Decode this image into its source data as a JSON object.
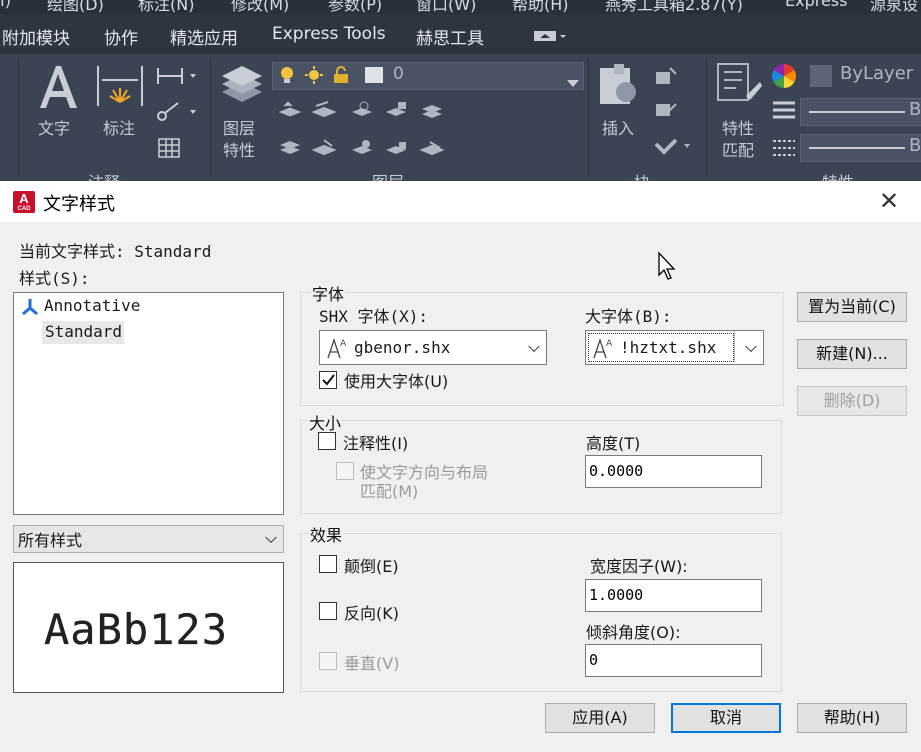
{
  "menubar": {
    "items": [
      "I)",
      "绘图(D)",
      "标注(N)",
      "修改(M)",
      "参数(P)",
      "窗口(W)",
      "帮助(H)",
      "燕秀工具箱2.87(Y)",
      "Express",
      "源泉设"
    ]
  },
  "tabs": [
    "附加模块",
    "协作",
    "精选应用",
    "Express Tools",
    "赫思工具"
  ],
  "ribbon": {
    "text_label": "文字",
    "dim_label": "标注",
    "layer_props": [
      "图层",
      "特性"
    ],
    "layer_value": "0",
    "insert_label": "插入",
    "match_props": [
      "特性",
      "匹配"
    ],
    "bylayer_label": "ByLayer",
    "line1_end": "B",
    "line2_end": "B",
    "group_labels": [
      "注释",
      "图层",
      "块",
      "特性"
    ]
  },
  "dialog": {
    "title": "文字样式",
    "app_icon_letter": "A",
    "app_icon_sub": "CAD",
    "close_glyph": "✕",
    "current_style_label": "当前文字样式: Standard",
    "styles_label": "样式(S):",
    "styles": [
      "Annotative",
      "Standard"
    ],
    "filter_value": "所有样式",
    "preview_text": "AaBb123",
    "font": {
      "group": "字体",
      "shx_label": "SHX 字体(X):",
      "shx_value": "gbenor.shx",
      "big_label": "大字体(B):",
      "big_value": "!hztxt.shx",
      "use_big_label": "使用大字体(U)",
      "use_big_checked": true
    },
    "size": {
      "group": "大小",
      "annotative_label": "注释性(I)",
      "match_orientation_line1": "使文字方向与布局",
      "match_orientation_line2": "匹配(M)",
      "height_label": "高度(T)",
      "height_value": "0.0000"
    },
    "effects": {
      "group": "效果",
      "upside_down": "颠倒(E)",
      "backwards": "反向(K)",
      "vertical": "垂直(V)",
      "width_label": "宽度因子(W):",
      "width_value": "1.0000",
      "oblique_label": "倾斜角度(O):",
      "oblique_value": "0"
    },
    "buttons": {
      "set_current": "置为当前(C)",
      "new": "新建(N)...",
      "delete": "删除(D)",
      "apply": "应用(A)",
      "cancel": "取消",
      "help": "帮助(H)"
    }
  }
}
